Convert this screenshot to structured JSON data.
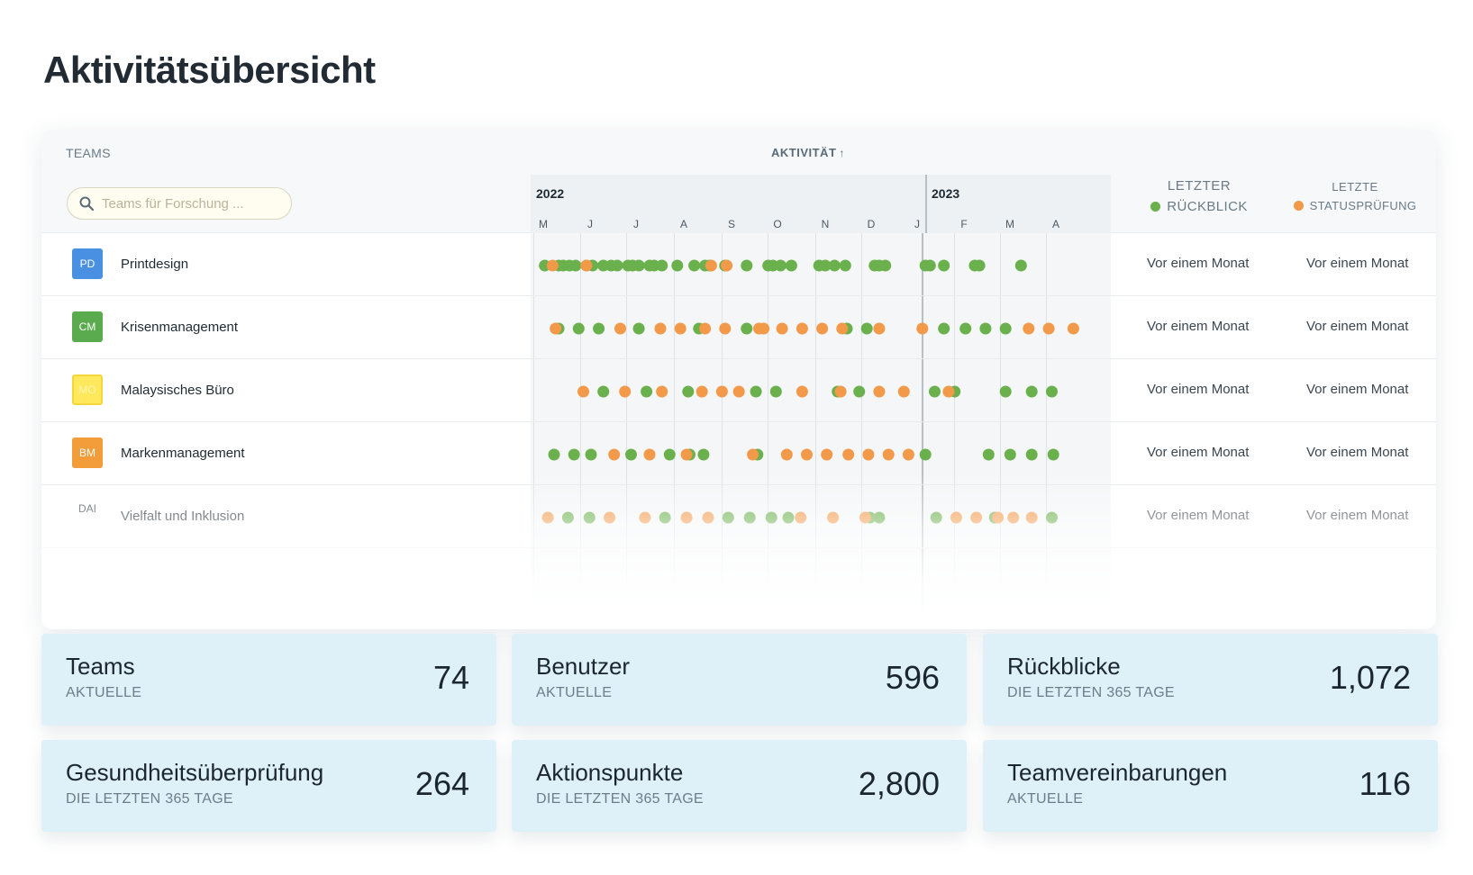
{
  "page": {
    "title": "Aktivitätsübersicht"
  },
  "table": {
    "teams_header": "TEAMS",
    "activity_header": "AKTIVITÄT",
    "activity_sort_icon": "arrow-up-icon",
    "search": {
      "placeholder": "Teams für Forschung ...",
      "value": ""
    },
    "timeline": {
      "years": [
        "2022",
        "2023"
      ],
      "months": [
        "M",
        "J",
        "J",
        "A",
        "S",
        "O",
        "N",
        "D",
        "J",
        "F",
        "M",
        "A"
      ]
    },
    "col_last_review": {
      "line1": "LETZTER",
      "line2": "RÜCKBLICK"
    },
    "col_last_check": {
      "line1": "LETZTE",
      "line2": "STATUSPRÜFUNG"
    },
    "colors": {
      "review": "#6ab04c",
      "status_check": "#f2994a"
    },
    "rows": [
      {
        "initials": "PD",
        "badge_color": "#4a90e2",
        "name": "Printdesign",
        "last_review": "Vor einem Monat",
        "last_check": "Vor einem Monat",
        "review_dates": [
          "2022-05-02",
          "2022-05-11",
          "2022-05-14",
          "2022-05-18",
          "2022-05-22",
          "2022-05-29",
          "2022-06-02",
          "2022-06-09",
          "2022-06-14",
          "2022-06-18",
          "2022-06-25",
          "2022-06-28",
          "2022-07-02",
          "2022-07-09",
          "2022-07-12",
          "2022-07-17",
          "2022-07-27",
          "2022-08-07",
          "2022-08-14",
          "2022-08-17",
          "2022-08-27",
          "2022-09-10",
          "2022-09-24",
          "2022-09-27",
          "2022-10-02",
          "2022-10-09",
          "2022-10-27",
          "2022-10-31",
          "2022-11-06",
          "2022-11-13",
          "2022-12-02",
          "2022-12-05",
          "2022-12-09",
          "2023-01-04",
          "2023-01-07",
          "2023-01-16",
          "2023-02-05",
          "2023-02-08",
          "2023-03-07"
        ],
        "status_dates": [
          "2022-05-07",
          "2022-05-29",
          "2022-08-18",
          "2022-08-28"
        ]
      },
      {
        "initials": "CM",
        "badge_color": "#5aab4e",
        "name": "Krisenmanagement",
        "last_review": "Vor einem Monat",
        "last_check": "Vor einem Monat",
        "review_dates": [
          "2022-05-11",
          "2022-05-24",
          "2022-06-06",
          "2022-07-02",
          "2022-08-10",
          "2022-09-10",
          "2022-11-14",
          "2022-11-27",
          "2023-01-16",
          "2023-01-30",
          "2023-02-12",
          "2023-02-25"
        ],
        "status_dates": [
          "2022-05-09",
          "2022-06-20",
          "2022-07-16",
          "2022-07-29",
          "2022-08-14",
          "2022-08-27",
          "2022-09-18",
          "2022-09-21",
          "2022-10-03",
          "2022-10-16",
          "2022-10-29",
          "2022-11-11",
          "2022-12-05",
          "2023-01-02",
          "2023-03-12",
          "2023-03-25",
          "2023-04-10"
        ]
      },
      {
        "initials": "MO",
        "badge_color": "#ffe85c",
        "name": "Malaysisches Büro",
        "last_review": "Vor einem Monat",
        "last_check": "Vor einem Monat",
        "review_dates": [
          "2022-06-09",
          "2022-07-07",
          "2022-08-03",
          "2022-09-16",
          "2022-09-29",
          "2022-11-08",
          "2022-11-22",
          "2023-01-10",
          "2023-01-23",
          "2023-02-25",
          "2023-03-14",
          "2023-03-27"
        ],
        "status_dates": [
          "2022-05-27",
          "2022-06-23",
          "2022-07-17",
          "2022-08-12",
          "2022-08-25",
          "2022-09-05",
          "2022-10-16",
          "2022-11-10",
          "2022-12-05",
          "2022-12-21",
          "2023-01-19"
        ]
      },
      {
        "initials": "BM",
        "badge_color": "#f39c3a",
        "name": "Markenmanagement",
        "last_review": "Vor einem Monat",
        "last_check": "Vor einem Monat",
        "review_dates": [
          "2022-05-08",
          "2022-05-21",
          "2022-06-01",
          "2022-06-27",
          "2022-07-22",
          "2022-08-04",
          "2022-08-13",
          "2022-09-17",
          "2023-01-04",
          "2023-02-14",
          "2023-02-28",
          "2023-03-14",
          "2023-03-28"
        ],
        "status_dates": [
          "2022-06-16",
          "2022-07-09",
          "2022-08-02",
          "2022-09-14",
          "2022-10-06",
          "2022-10-19",
          "2022-11-01",
          "2022-11-15",
          "2022-11-28",
          "2022-12-11",
          "2022-12-24"
        ]
      },
      {
        "initials": "DAI",
        "badge_color": "",
        "name": "Vielfalt und Inklusion",
        "last_review": "Vor einem Monat",
        "last_check": "Vor einem Monat",
        "review_dates": [
          "2022-05-17",
          "2022-05-31",
          "2022-07-19",
          "2022-08-29",
          "2022-09-12",
          "2022-09-26",
          "2022-10-07",
          "2022-11-29",
          "2022-12-05",
          "2023-01-11",
          "2023-02-18",
          "2023-03-27"
        ],
        "status_dates": [
          "2022-05-04",
          "2022-06-13",
          "2022-07-06",
          "2022-08-02",
          "2022-08-16",
          "2022-10-15",
          "2022-11-05",
          "2022-11-26",
          "2023-01-24",
          "2023-02-06",
          "2023-02-20",
          "2023-03-02",
          "2023-03-14"
        ]
      }
    ]
  },
  "stats": [
    {
      "title": "Teams",
      "subtitle": "AKTUELLE",
      "value": "74"
    },
    {
      "title": "Benutzer",
      "subtitle": "AKTUELLE",
      "value": "596"
    },
    {
      "title": "Rückblicke",
      "subtitle": "DIE LETZTEN 365 TAGE",
      "value": "1,072"
    },
    {
      "title": "Gesundheitsüberprüfung",
      "subtitle": "DIE LETZTEN 365 TAGE",
      "value": "264"
    },
    {
      "title": "Aktionspunkte",
      "subtitle": "DIE LETZTEN 365 TAGE",
      "value": "2,800"
    },
    {
      "title": "Teamvereinbarungen",
      "subtitle": "AKTUELLE",
      "value": "116"
    }
  ]
}
